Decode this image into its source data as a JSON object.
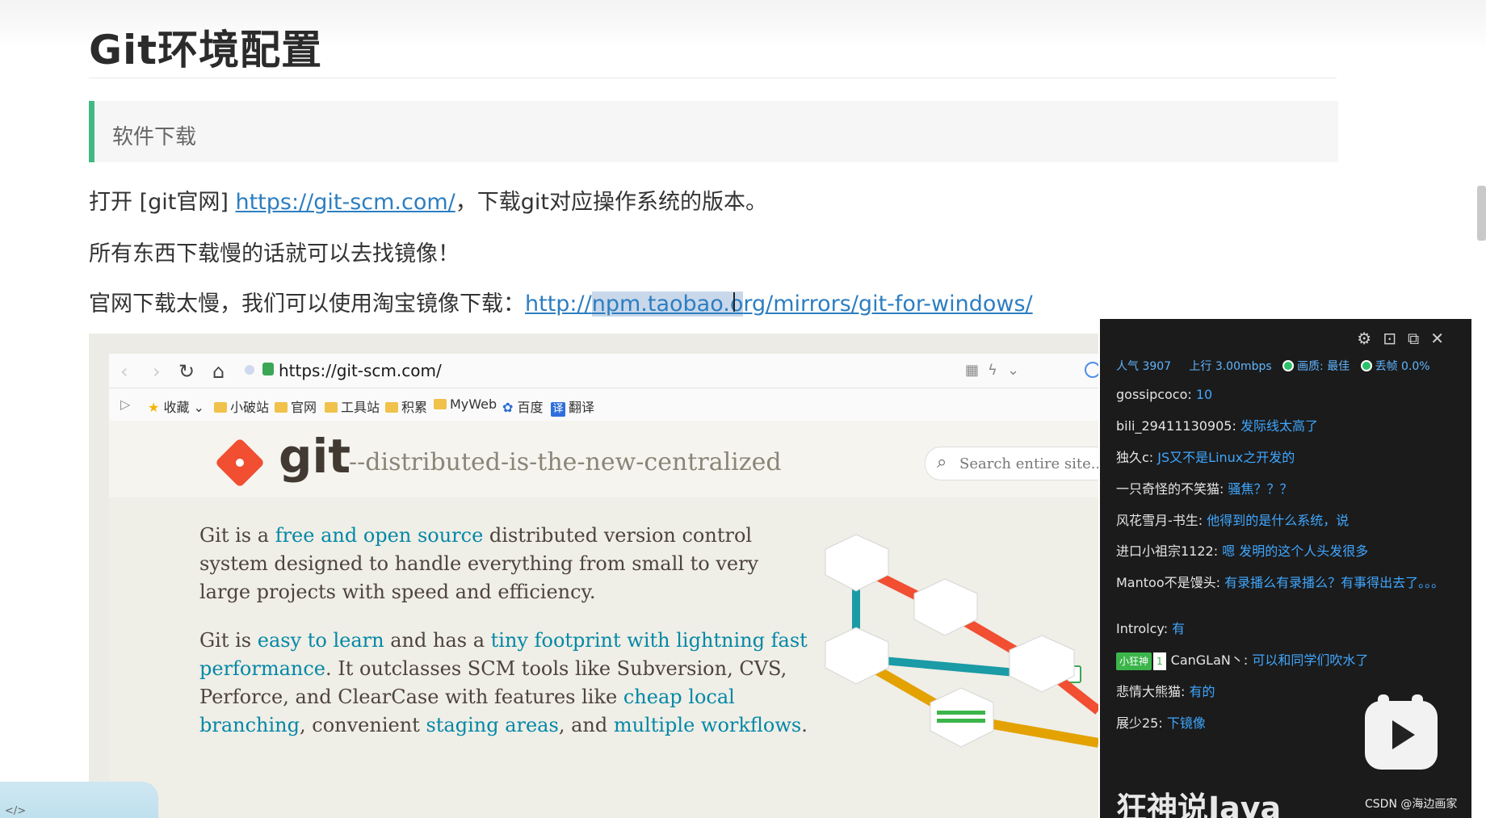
{
  "article": {
    "title": "Git环境配置",
    "callout": "软件下载",
    "p1_before": "打开 [git官网] ",
    "p1_link": "https://git-scm.com/",
    "p1_after": "，下载git对应操作系统的版本。",
    "p2": "所有东西下载慢的话就可以去找镜像！",
    "p3_before": "官网下载太慢，我们可以使用淘宝镜像下载：",
    "p3_link_a": "http://",
    "p3_link_hl": "npm.taobao.o",
    "p3_link_b": "rg/mirrors/git-for-windows/"
  },
  "browser": {
    "url": "https://git-scm.com/",
    "bookmarks": [
      "收藏",
      "小破站",
      "官网",
      "工具站",
      "积累",
      "MyWeb",
      "百度",
      "翻译"
    ]
  },
  "gitsite": {
    "wordmark": "git",
    "tagline": "--distributed-is-the-new-centralized",
    "search_placeholder": "Search entire site...",
    "para1_a": "Git is a ",
    "para1_link": "free and open source",
    "para1_b": " distributed version control system designed to handle everything from small to very large projects with speed and efficiency.",
    "para2_a": "Git is ",
    "para2_link1": "easy to learn",
    "para2_b": " and has a ",
    "para2_link2": "tiny footprint with lightning fast performance",
    "para2_c": ". It outclasses SCM tools like Subversion, CVS, Perforce, and ClearCase with features like ",
    "para2_link3": "cheap local branching",
    "para2_d": ", convenient ",
    "para2_link4": "staging areas",
    "para2_e": ", and ",
    "para2_link5": "multiple workflows",
    "para2_f": "."
  },
  "chat": {
    "stats": {
      "popularity_label": "人气",
      "popularity": "3907",
      "upload_label": "上行",
      "upload": "3.00mbps",
      "quality": "画质: 最佳",
      "drop": "丢帧 0.0%"
    },
    "messages": [
      {
        "user": "gossipcoco: ",
        "text": "10"
      },
      {
        "user": "bili_29411130905: ",
        "text": "发际线太高了"
      },
      {
        "user": "独久c: ",
        "text": "JS又不是Linux之开发的"
      },
      {
        "user": "一只奇怪的不笑猫: ",
        "text": "骚焦？？？"
      },
      {
        "user": "风花雪月-书生: ",
        "text": "他得到的是什么系统，说"
      },
      {
        "user": "进口小祖宗1122: ",
        "text": "嗯  发明的这个人头发很多"
      },
      {
        "user": "Mantoo不是馒头: ",
        "text": "有录播么有录播么？有事得出去了。。。"
      },
      {
        "user": "Introlcy: ",
        "text": "有"
      },
      {
        "user": "CanGLaN丶: ",
        "text": "可以和同学们吹水了",
        "badge": "小狂神",
        "badge_level": "1"
      },
      {
        "user": "悲情大熊猫: ",
        "text": "有的"
      },
      {
        "user": "展少25: ",
        "text": "下镜像"
      }
    ],
    "watermark": "狂神说Java"
  },
  "overlay": {
    "csdn": "CSDN @海边画家"
  },
  "colors": {
    "accent_green": "#42b983",
    "link_blue": "#2c7ec1",
    "git_red": "#f14e32",
    "chat_bg": "#1b1b1b",
    "chat_text_blue": "#3fa7ff"
  }
}
